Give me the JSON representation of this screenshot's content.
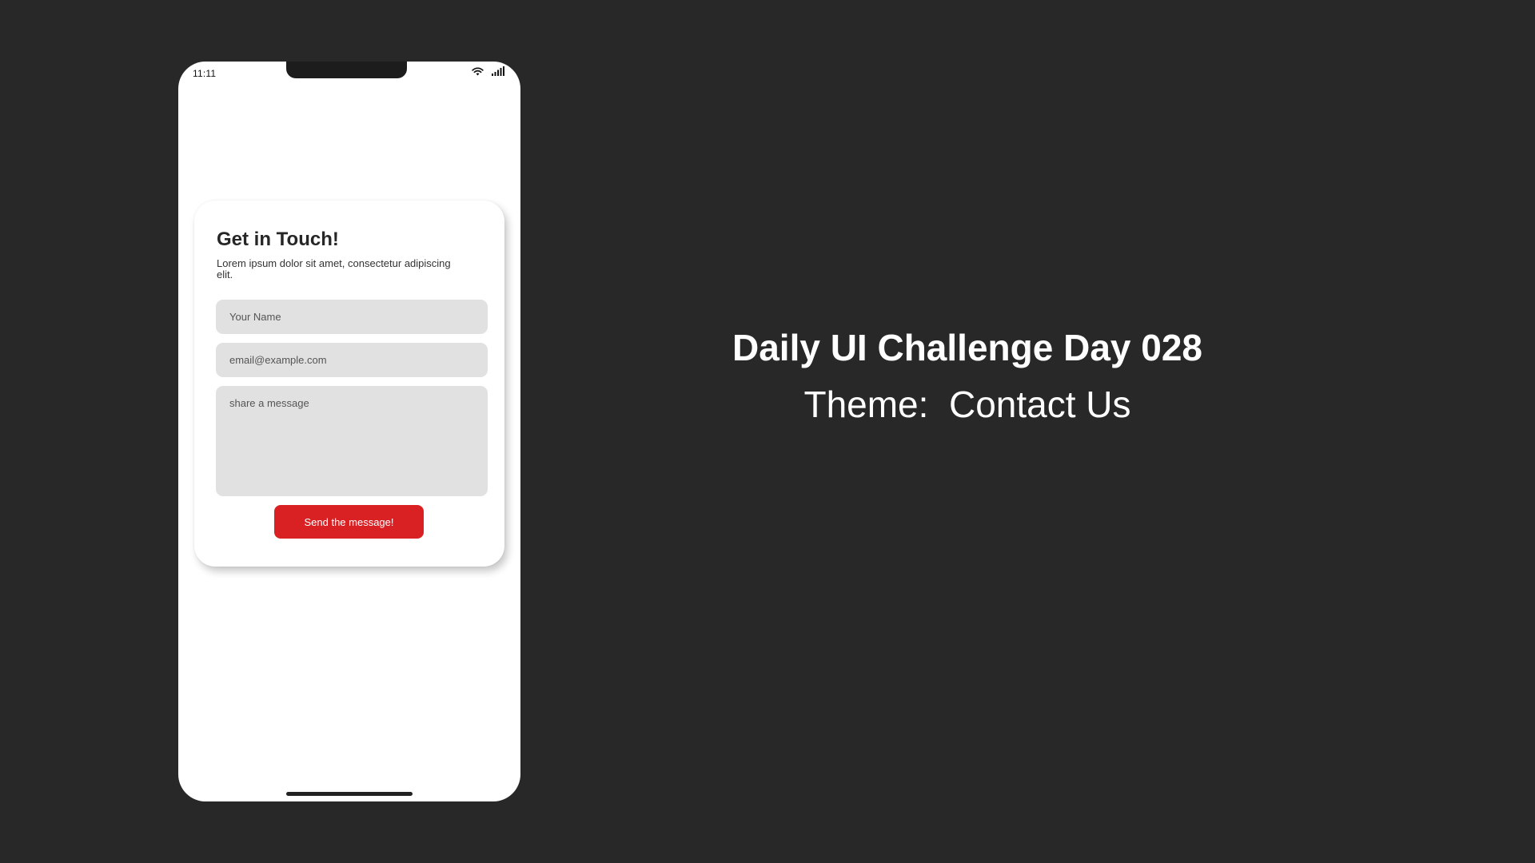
{
  "status_bar": {
    "time": "11:11",
    "icons": [
      "wifi-icon",
      "signal-bars-icon"
    ]
  },
  "contact_card": {
    "title": "Get in Touch!",
    "description": "Lorem ipsum dolor sit amet, consectetur adipiscing elit.",
    "name_placeholder": "Your Name",
    "email_placeholder": "email@example.com",
    "message_placeholder": "share a message",
    "submit_label": "Send the message!"
  },
  "headline": {
    "title": "Daily UI Challenge Day 028",
    "subtitle": "Theme:  Contact Us"
  },
  "colors": {
    "background": "#282828",
    "accent": "#d92124",
    "field_background": "#e1e1e1",
    "card_background": "#ffffff"
  }
}
